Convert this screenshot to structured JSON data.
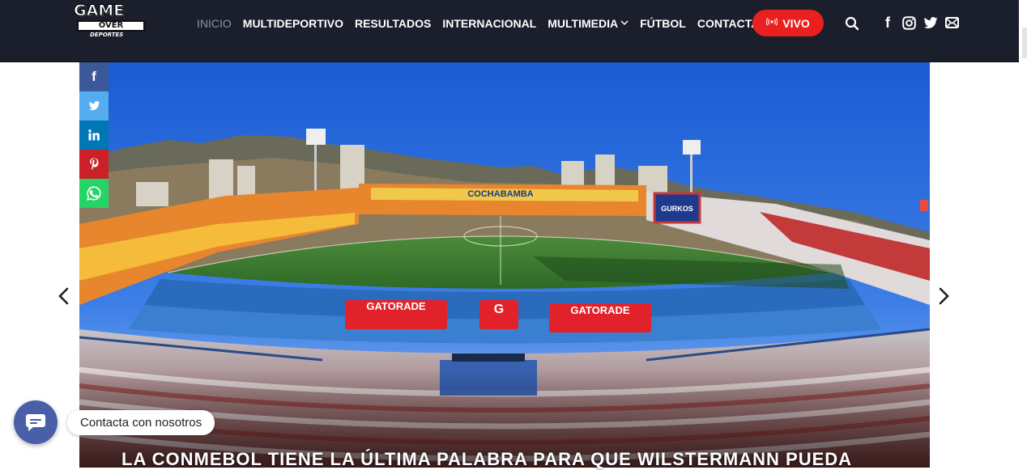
{
  "brand": {
    "logo_line1": "GAME",
    "logo_line2": "OVER",
    "logo_line3": "DEPORTES"
  },
  "nav": {
    "items": [
      {
        "label": "INICIO",
        "active": true
      },
      {
        "label": "MULTIDEPORTIVO"
      },
      {
        "label": "RESULTADOS"
      },
      {
        "label": "INTERNACIONAL"
      },
      {
        "label": "MULTIMEDIA",
        "has_dropdown": true
      },
      {
        "label": "FÚTBOL"
      },
      {
        "label": "CONTACTANOS"
      }
    ],
    "live_label": "VIVO",
    "live_color": "#e9201f"
  },
  "header_icons": [
    "search-icon",
    "facebook-icon",
    "instagram-icon",
    "twitter-icon",
    "mail-icon"
  ],
  "share_bar": [
    {
      "name": "facebook",
      "color": "#3b5998"
    },
    {
      "name": "twitter",
      "color": "#55acee"
    },
    {
      "name": "linkedin",
      "color": "#0077b5"
    },
    {
      "name": "pinterest",
      "color": "#cb2027"
    },
    {
      "name": "whatsapp",
      "color": "#25d366"
    }
  ],
  "hero": {
    "headline": "LA CONMEBOL TIENE LA ÚLTIMA PALABRA PARA QUE WILSTERMANN PUEDA",
    "stadium_name": "COCHABAMBA",
    "banner_text": "GURKOS",
    "ad_text": "GATORADE",
    "ad_logo": "G"
  },
  "chat": {
    "label": "Contacta con nosotros"
  },
  "colors": {
    "header_bg": "#1b1e2b",
    "accent": "#e9201f",
    "chat": "#4a5fa8"
  }
}
